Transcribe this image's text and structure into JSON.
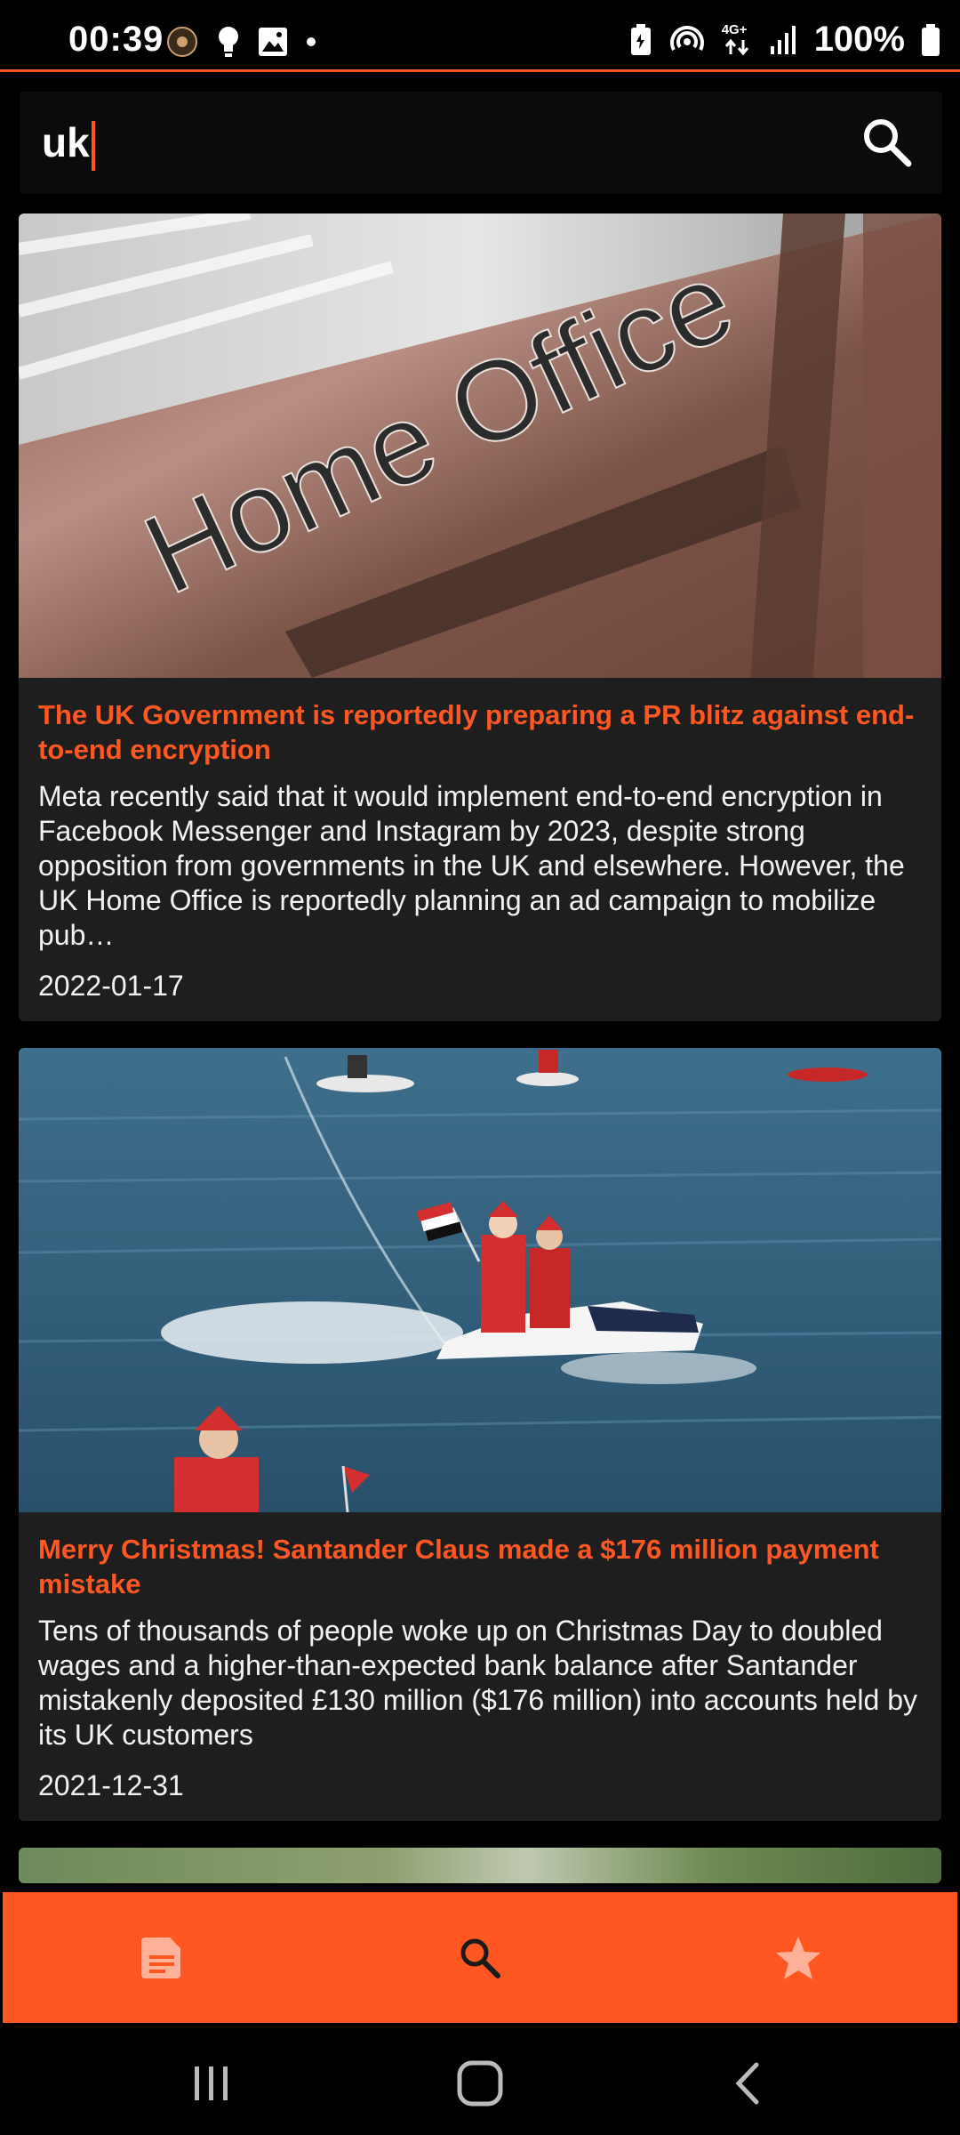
{
  "status_bar": {
    "time": "00:39",
    "battery_percent": "100%",
    "network": "4G+",
    "icons_left": [
      "app-notification-icon",
      "lightbulb-icon",
      "image-icon",
      "dot-icon"
    ],
    "icons_right": [
      "battery-saver-icon",
      "hotspot-icon",
      "data-arrows-icon",
      "signal-icon",
      "battery-icon"
    ]
  },
  "search": {
    "value": "uk",
    "button_icon": "search-icon"
  },
  "articles": [
    {
      "image_caption": "Home Office",
      "title": "The UK Government is reportedly preparing a PR blitz against end-to-end encryption",
      "description": "Meta recently said that it would implement end-to-end encryption in Facebook Messenger and Instagram by 2023, despite strong opposition from governments in the UK and elsewhere. However, the UK Home Office is reportedly planning an ad campaign to mobilize pub…",
      "date": "2022-01-17"
    },
    {
      "title": "Merry Christmas! Santander Claus made a $176 million payment mistake",
      "description": "Tens of thousands of people woke up on Christmas Day to doubled wages and a higher-than-expected bank balance after Santander mistakenly deposited £130 million ($176 million) into accounts held by its UK customers",
      "date": "2021-12-31"
    }
  ],
  "bottom_nav": {
    "items": [
      {
        "icon": "article-icon",
        "active": false
      },
      {
        "icon": "search-icon",
        "active": true
      },
      {
        "icon": "star-icon",
        "active": false
      }
    ],
    "color": "#ff5722"
  },
  "colors": {
    "accent": "#ff5722",
    "card_bg": "#1e1e1e",
    "background": "#000000"
  }
}
